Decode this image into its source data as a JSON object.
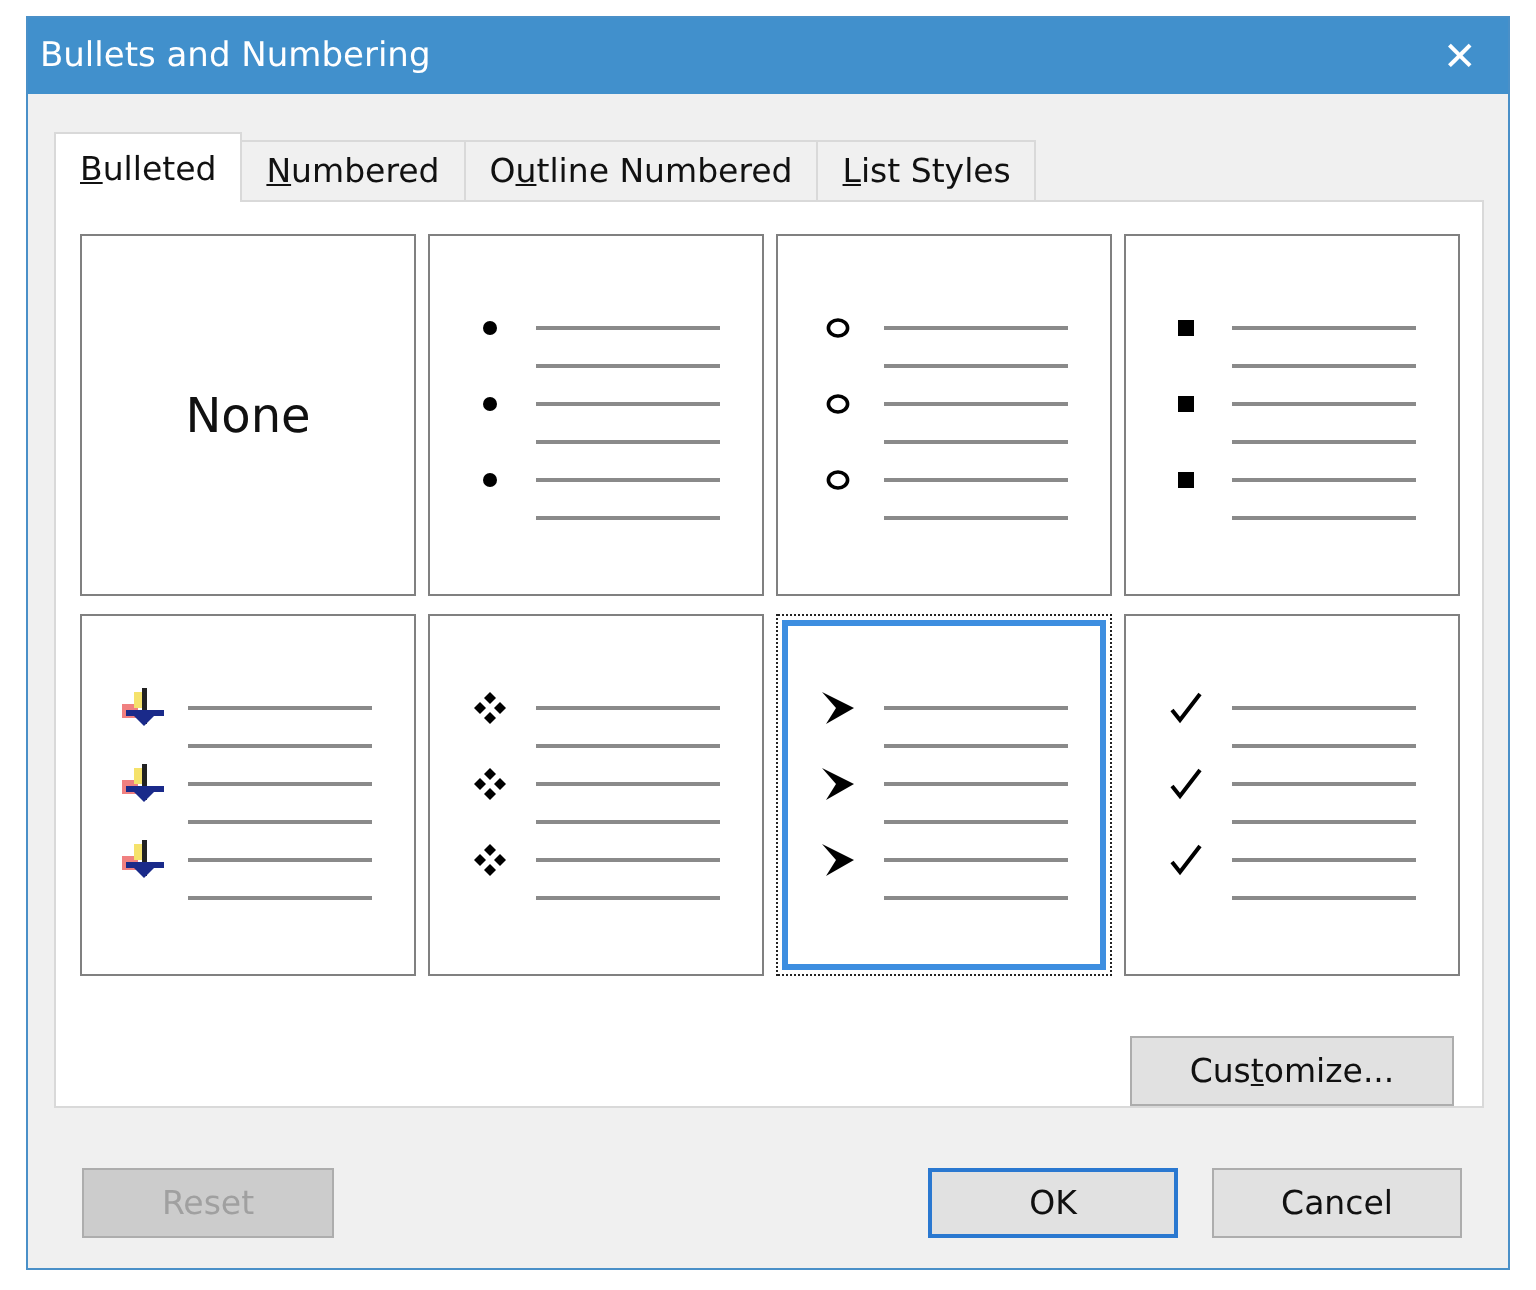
{
  "window": {
    "title": "Bullets and Numbering",
    "close": "✕"
  },
  "tabs": [
    {
      "key": "B",
      "after": "ulleted",
      "selected": true
    },
    {
      "key": "N",
      "after": "umbered",
      "selected": false
    },
    {
      "before": "O",
      "key": "u",
      "after": "tline Numbered",
      "selected": false
    },
    {
      "key": "L",
      "after": "ist Styles",
      "selected": false
    }
  ],
  "bullet_styles": [
    {
      "kind": "none",
      "label": "None",
      "selected": false
    },
    {
      "kind": "disc",
      "selected": false
    },
    {
      "kind": "circle",
      "selected": false
    },
    {
      "kind": "square",
      "selected": false
    },
    {
      "kind": "picture",
      "selected": false
    },
    {
      "kind": "diamonds",
      "selected": false
    },
    {
      "kind": "arrowhead",
      "selected": true
    },
    {
      "kind": "check",
      "selected": false
    }
  ],
  "customize_button": {
    "before": "Cus",
    "key": "t",
    "after": "omize..."
  },
  "buttons": [
    {
      "kind": "reset",
      "label": "Reset",
      "disabled": true
    },
    {
      "kind": "ok",
      "label": "OK",
      "disabled": false
    },
    {
      "kind": "cancel",
      "label": "Cancel",
      "disabled": false
    }
  ]
}
